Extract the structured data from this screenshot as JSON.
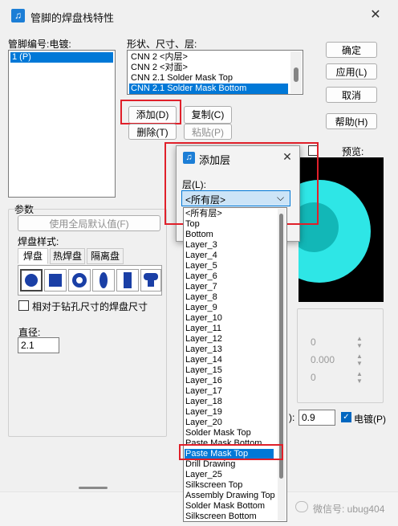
{
  "window": {
    "title": "管脚的焊盘栈特性",
    "close_glyph": "✕",
    "icon": "app-logo-icon"
  },
  "left": {
    "list_label": "管脚编号:电镀:",
    "items": [
      "1 (P)"
    ]
  },
  "shapes": {
    "label": "形状、尺寸、层:",
    "items": [
      "CNN 2 <内层>",
      "CNN 2 <对面>",
      "CNN 2.1 Solder Mask Top",
      "CNN 2.1 Solder Mask Bottom"
    ],
    "selected_index": 3
  },
  "buttons": {
    "add": "添加(D)",
    "copy": "复制(C)",
    "delete": "删除(T)",
    "paste": "粘贴(P)"
  },
  "right_buttons": {
    "ok": "确定",
    "apply": "应用(L)",
    "cancel": "取消",
    "help": "帮助(H)"
  },
  "preview": {
    "label": "预览:"
  },
  "params": {
    "group_label": "参数",
    "use_default": "使用全局默认值(F)",
    "pad_style_label": "焊盘样式:",
    "tabs": [
      "焊盘",
      "热焊盘",
      "隔离盘"
    ],
    "active_tab": 0,
    "relative_check": "相对于钻孔尺寸的焊盘尺寸",
    "diameter_label": "直径:",
    "diameter_value": "2.1"
  },
  "right_fields": {
    "values": [
      "0",
      "0.000",
      "0"
    ],
    "ratio_label": "):",
    "ratio_value": "0.9",
    "plated_label": "电镀(P)"
  },
  "add_layer_dialog": {
    "title": "添加层",
    "close_glyph": "✕",
    "layer_label": "层(L):",
    "selected": "<所有层>",
    "options": [
      "<所有层>",
      "Top",
      "Bottom",
      "Layer_3",
      "Layer_4",
      "Layer_5",
      "Layer_6",
      "Layer_7",
      "Layer_8",
      "Layer_9",
      "Layer_10",
      "Layer_11",
      "Layer_12",
      "Layer_13",
      "Layer_14",
      "Layer_15",
      "Layer_16",
      "Layer_17",
      "Layer_18",
      "Layer_19",
      "Layer_20",
      "Solder Mask Top",
      "Paste Mask Bottom",
      "Paste Mask Top",
      "Drill Drawing",
      "Layer_25",
      "Silkscreen Top",
      "Assembly Drawing Top",
      "Solder Mask Bottom",
      "Silkscreen Bottom"
    ],
    "highlighted_index": 23
  },
  "watermark": {
    "text": "微信号: ubug404"
  },
  "colors": {
    "accent": "#0078d7",
    "annotation": "#e0202a",
    "pad_fill": "#1a3fa6",
    "preview_cyan": "#2ee6e6"
  }
}
